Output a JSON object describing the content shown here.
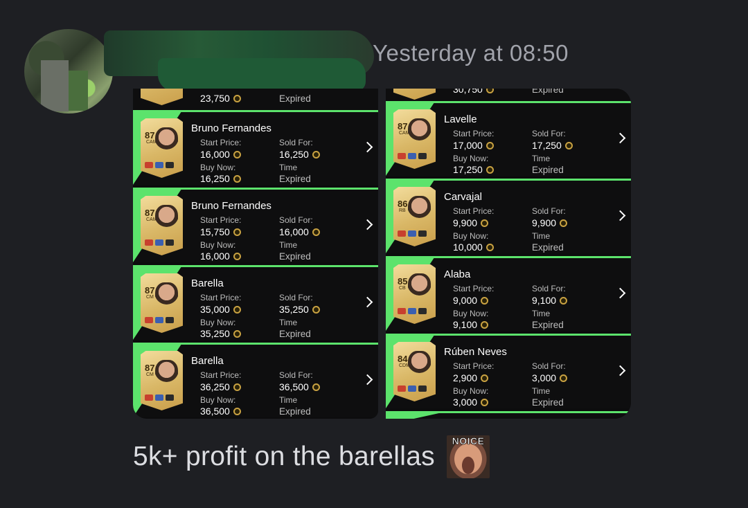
{
  "header": {
    "timestamp": "Yesterday at 08:50"
  },
  "message": {
    "text": "5k+ profit on the barellas",
    "emoji_label": "NOICE",
    "emoji_name": "noice-emoji"
  },
  "labels": {
    "start_price": "Start Price:",
    "sold_for": "Sold For:",
    "buy_now": "Buy Now:",
    "time": "Time",
    "expired": "Expired"
  },
  "left_top_partial": {
    "buy_now": "23,750",
    "time": "Expired"
  },
  "right_top_partial": {
    "buy_now": "30,750",
    "time": "Expired"
  },
  "left_listings": [
    {
      "name": "Bruno Fernandes",
      "rating": "87",
      "position": "CAM",
      "start_price": "16,000",
      "sold_for": "16,250",
      "buy_now": "16,250",
      "time": "Expired"
    },
    {
      "name": "Bruno Fernandes",
      "rating": "87",
      "position": "CAM",
      "start_price": "15,750",
      "sold_for": "16,000",
      "buy_now": "16,000",
      "time": "Expired"
    },
    {
      "name": "Barella",
      "rating": "87",
      "position": "CM",
      "start_price": "35,000",
      "sold_for": "35,250",
      "buy_now": "35,250",
      "time": "Expired"
    },
    {
      "name": "Barella",
      "rating": "87",
      "position": "CM",
      "start_price": "36,250",
      "sold_for": "36,500",
      "buy_now": "36,500",
      "time": "Expired"
    }
  ],
  "right_listings": [
    {
      "name": "Lavelle",
      "rating": "87",
      "position": "CAM",
      "start_price": "17,000",
      "sold_for": "17,250",
      "buy_now": "17,250",
      "time": "Expired"
    },
    {
      "name": "Carvajal",
      "rating": "86",
      "position": "RB",
      "start_price": "9,900",
      "sold_for": "9,900",
      "buy_now": "10,000",
      "time": "Expired"
    },
    {
      "name": "Alaba",
      "rating": "85",
      "position": "CB",
      "start_price": "9,000",
      "sold_for": "9,100",
      "buy_now": "9,100",
      "time": "Expired"
    },
    {
      "name": "Rúben Neves",
      "rating": "84",
      "position": "CDM",
      "start_price": "2,900",
      "sold_for": "3,000",
      "buy_now": "3,000",
      "time": "Expired"
    }
  ],
  "colors": {
    "accent_green": "#5ce36c",
    "coin_gold": "#c9a242",
    "background": "#1e1f23"
  }
}
